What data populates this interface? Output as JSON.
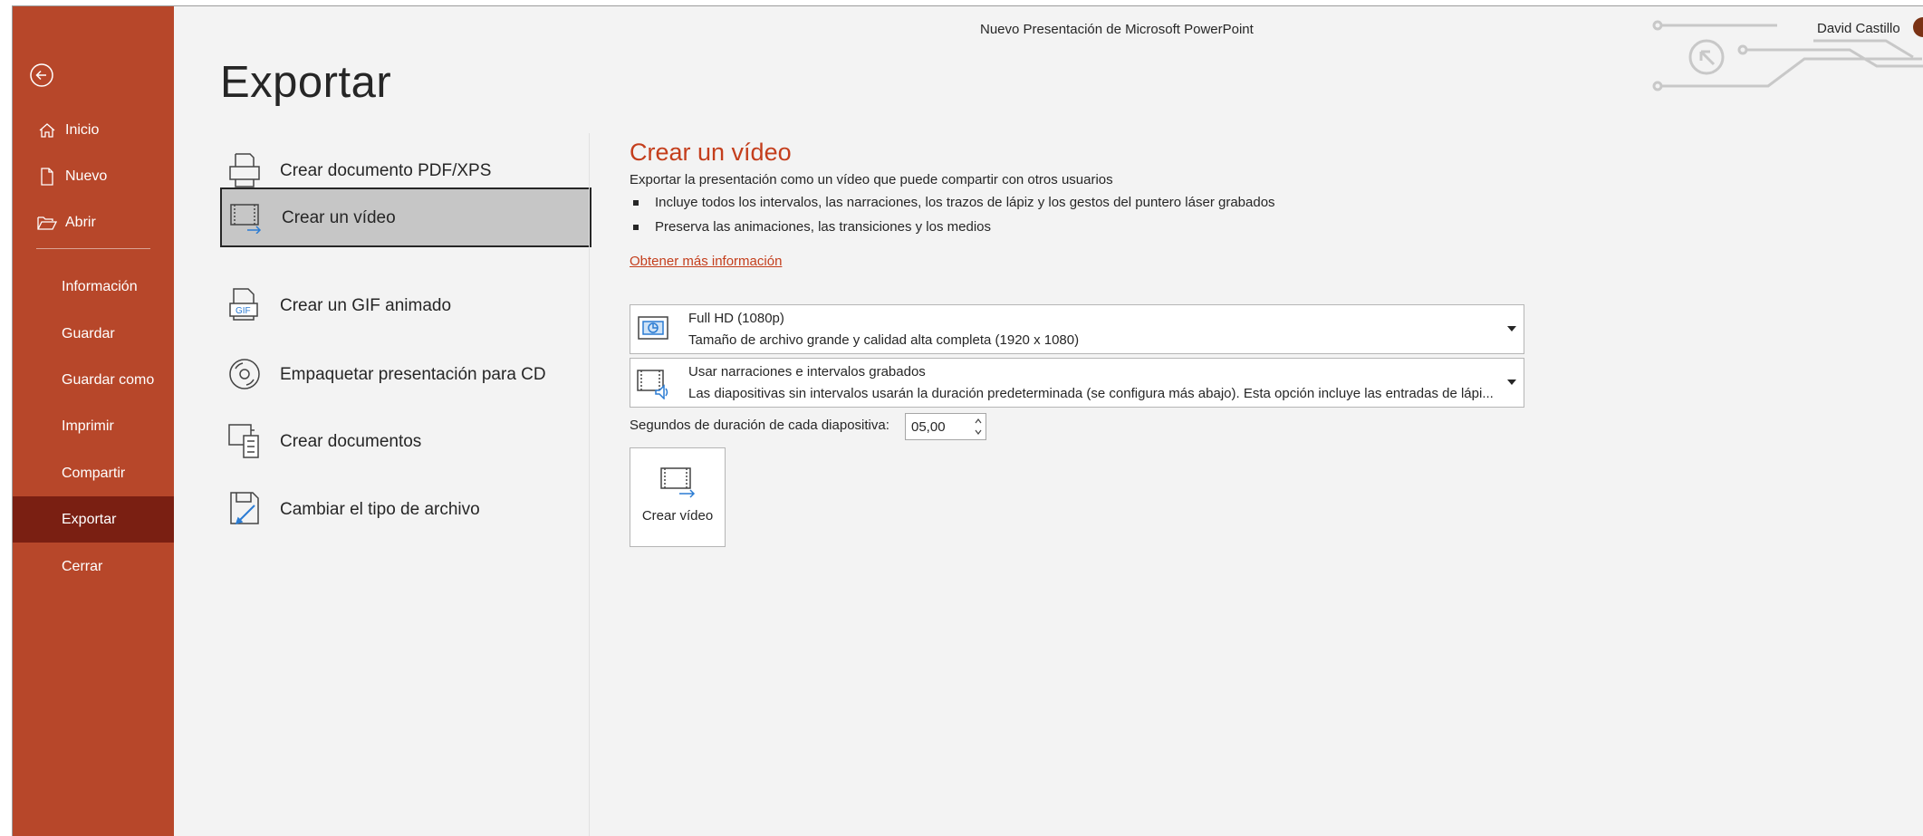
{
  "window": {
    "title": "Nuevo Presentación de Microsoft PowerPoint",
    "user_name": "David Castillo"
  },
  "sidebar": {
    "items": [
      {
        "label": "Inicio",
        "icon": "home-icon"
      },
      {
        "label": "Nuevo",
        "icon": "new-document-icon"
      },
      {
        "label": "Abrir",
        "icon": "open-folder-icon"
      },
      {
        "label": "Información"
      },
      {
        "label": "Guardar"
      },
      {
        "label": "Guardar como"
      },
      {
        "label": "Imprimir"
      },
      {
        "label": "Compartir"
      },
      {
        "label": "Exportar",
        "active": true
      },
      {
        "label": "Cerrar"
      }
    ]
  },
  "page": {
    "title": "Exportar"
  },
  "export_options": [
    {
      "label": "Crear documento PDF/XPS",
      "icon": "pdf-document-icon"
    },
    {
      "label": "Crear un vídeo",
      "icon": "video-icon",
      "selected": true
    },
    {
      "label": "Crear un GIF animado",
      "icon": "gif-icon"
    },
    {
      "label": "Empaquetar presentación para CD",
      "icon": "cd-icon"
    },
    {
      "label": "Crear documentos",
      "icon": "handouts-icon"
    },
    {
      "label": "Cambiar el tipo de archivo",
      "icon": "change-file-type-icon"
    }
  ],
  "detail": {
    "title": "Crear un vídeo",
    "description": "Exportar la presentación como un vídeo que puede compartir con otros usuarios",
    "bullets": [
      "Incluye todos los intervalos, las narraciones, los trazos de lápiz y los gestos del puntero láser grabados",
      "Preserva las animaciones, las transiciones y los medios"
    ],
    "learn_more": "Obtener más información",
    "quality_dropdown": {
      "main": "Full HD (1080p)",
      "sub": "Tamaño de archivo grande y calidad alta completa (1920 x 1080)"
    },
    "timing_dropdown": {
      "main": "Usar narraciones e intervalos grabados",
      "sub": "Las diapositivas sin intervalos usarán la duración predeterminada (se configura más abajo). Esta opción incluye las entradas de lápi..."
    },
    "seconds_label": "Segundos de duración de cada diapositiva:",
    "seconds_value": "05,00",
    "create_button": "Crear vídeo"
  },
  "colors": {
    "sidebar": "#b7472a",
    "sidebar_active": "#7a1f12",
    "accent": "#c43e1c"
  }
}
